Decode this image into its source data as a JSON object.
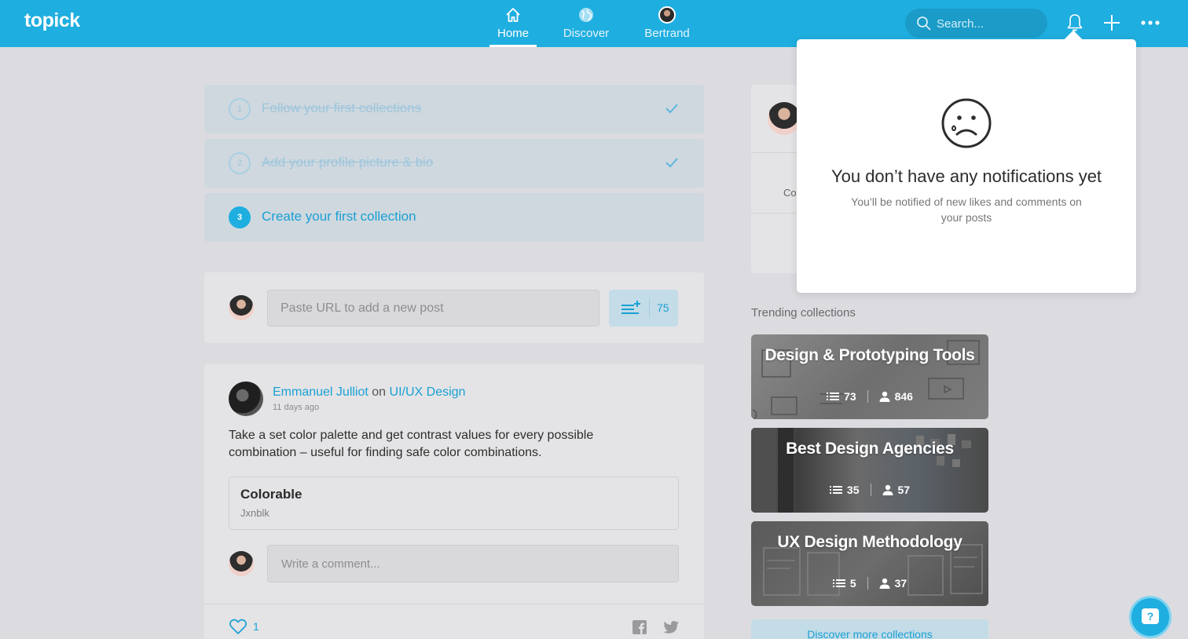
{
  "app": {
    "logo": "topick"
  },
  "nav": [
    {
      "label": "Home",
      "icon": "home-icon",
      "active": true
    },
    {
      "label": "Discover",
      "icon": "globe-icon",
      "active": false
    },
    {
      "label": "Bertrand",
      "icon": "avatar",
      "active": false
    }
  ],
  "search": {
    "placeholder": "Search..."
  },
  "onboarding": [
    {
      "number": "1",
      "label": "Follow your first collections",
      "done": true
    },
    {
      "number": "2",
      "label": "Add your profile picture & bio",
      "done": true
    },
    {
      "number": "3",
      "label": "Create your first collection",
      "done": false
    }
  ],
  "composer": {
    "placeholder": "Paste URL to add a new post",
    "count": "75"
  },
  "post": {
    "author": "Emmanuel Julliot",
    "on": "on",
    "collection": "UI/UX Design",
    "time": "11 days ago",
    "body": "Take a set color palette and get contrast values for every possible combination – useful for finding safe color combinations.",
    "link_title": "Colorable",
    "link_sub": "Jxnblk",
    "comment_placeholder": "Write a comment...",
    "likes": "1"
  },
  "profile_partial": "Co",
  "trending": {
    "title": "Trending collections",
    "items": [
      {
        "name": "Design & Prototyping Tools",
        "posts": "73",
        "followers": "846"
      },
      {
        "name": "Best Design Agencies",
        "posts": "35",
        "followers": "57"
      },
      {
        "name": "UX Design Methodology",
        "posts": "5",
        "followers": "37"
      }
    ],
    "more": "Discover more collections"
  },
  "notifications": {
    "title": "You don’t have any notifications yet",
    "subtitle": "You’ll be notified of new likes and comments on your posts"
  },
  "help": {
    "label": "?"
  },
  "colors": {
    "accent": "#1faee0",
    "link": "#1aa0d3",
    "background": "#dcdce0"
  }
}
